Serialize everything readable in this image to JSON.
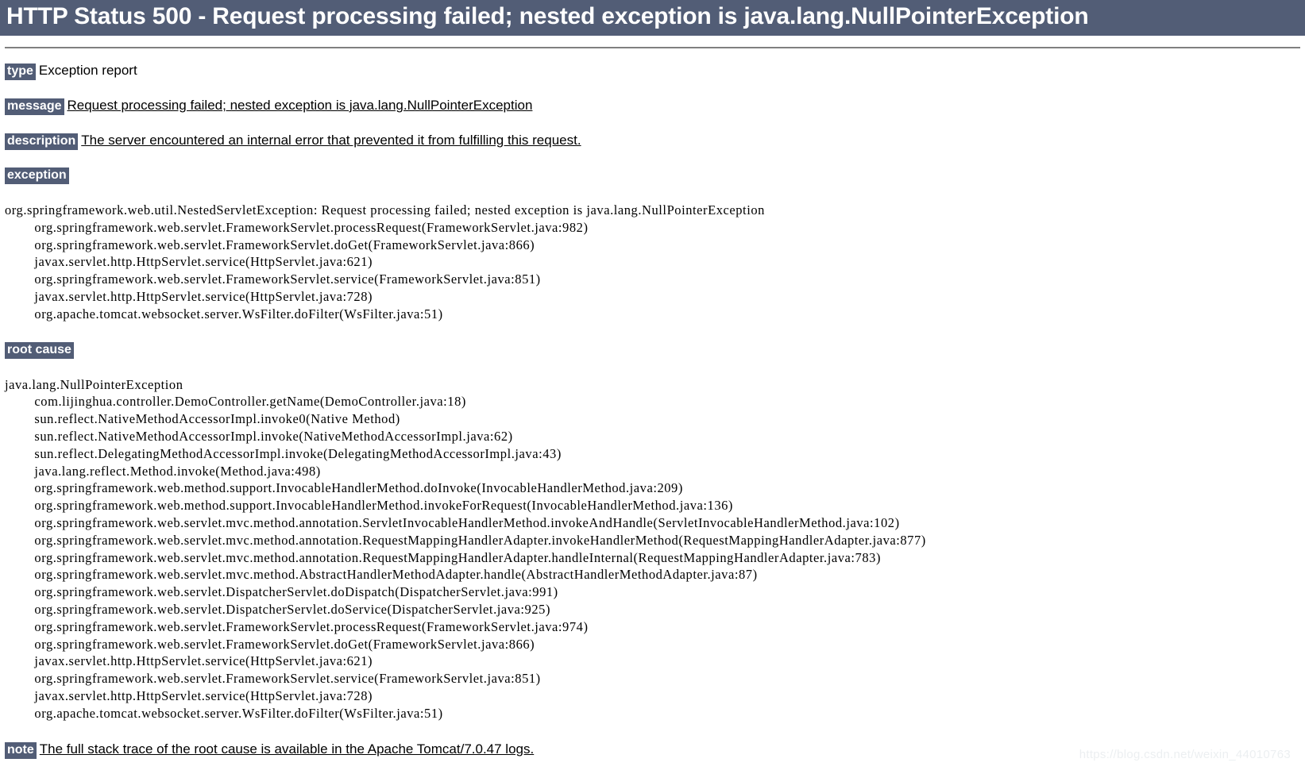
{
  "header": {
    "title": "HTTP Status 500 - Request processing failed; nested exception is java.lang.NullPointerException",
    "bg_color": "#525D76",
    "text_color": "#ffffff"
  },
  "fields": {
    "type_label": "type",
    "type_value": "Exception report",
    "message_label": "message",
    "message_value": "Request processing failed; nested exception is java.lang.NullPointerException",
    "description_label": "description",
    "description_value": "The server encountered an internal error that prevented it from fulfilling this request."
  },
  "exception": {
    "label": "exception",
    "trace": "org.springframework.web.util.NestedServletException: Request processing failed; nested exception is java.lang.NullPointerException\n\torg.springframework.web.servlet.FrameworkServlet.processRequest(FrameworkServlet.java:982)\n\torg.springframework.web.servlet.FrameworkServlet.doGet(FrameworkServlet.java:866)\n\tjavax.servlet.http.HttpServlet.service(HttpServlet.java:621)\n\torg.springframework.web.servlet.FrameworkServlet.service(FrameworkServlet.java:851)\n\tjavax.servlet.http.HttpServlet.service(HttpServlet.java:728)\n\torg.apache.tomcat.websocket.server.WsFilter.doFilter(WsFilter.java:51)"
  },
  "root_cause": {
    "label": "root cause",
    "trace": "java.lang.NullPointerException\n\tcom.lijinghua.controller.DemoController.getName(DemoController.java:18)\n\tsun.reflect.NativeMethodAccessorImpl.invoke0(Native Method)\n\tsun.reflect.NativeMethodAccessorImpl.invoke(NativeMethodAccessorImpl.java:62)\n\tsun.reflect.DelegatingMethodAccessorImpl.invoke(DelegatingMethodAccessorImpl.java:43)\n\tjava.lang.reflect.Method.invoke(Method.java:498)\n\torg.springframework.web.method.support.InvocableHandlerMethod.doInvoke(InvocableHandlerMethod.java:209)\n\torg.springframework.web.method.support.InvocableHandlerMethod.invokeForRequest(InvocableHandlerMethod.java:136)\n\torg.springframework.web.servlet.mvc.method.annotation.ServletInvocableHandlerMethod.invokeAndHandle(ServletInvocableHandlerMethod.java:102)\n\torg.springframework.web.servlet.mvc.method.annotation.RequestMappingHandlerAdapter.invokeHandlerMethod(RequestMappingHandlerAdapter.java:877)\n\torg.springframework.web.servlet.mvc.method.annotation.RequestMappingHandlerAdapter.handleInternal(RequestMappingHandlerAdapter.java:783)\n\torg.springframework.web.servlet.mvc.method.AbstractHandlerMethodAdapter.handle(AbstractHandlerMethodAdapter.java:87)\n\torg.springframework.web.servlet.DispatcherServlet.doDispatch(DispatcherServlet.java:991)\n\torg.springframework.web.servlet.DispatcherServlet.doService(DispatcherServlet.java:925)\n\torg.springframework.web.servlet.FrameworkServlet.processRequest(FrameworkServlet.java:974)\n\torg.springframework.web.servlet.FrameworkServlet.doGet(FrameworkServlet.java:866)\n\tjavax.servlet.http.HttpServlet.service(HttpServlet.java:621)\n\torg.springframework.web.servlet.FrameworkServlet.service(FrameworkServlet.java:851)\n\tjavax.servlet.http.HttpServlet.service(HttpServlet.java:728)\n\torg.apache.tomcat.websocket.server.WsFilter.doFilter(WsFilter.java:51)"
  },
  "note": {
    "label": "note",
    "value": "The full stack trace of the root cause is available in the Apache Tomcat/7.0.47 logs."
  },
  "watermark": {
    "text": "https://blog.csdn.net/weixin_44010763"
  }
}
